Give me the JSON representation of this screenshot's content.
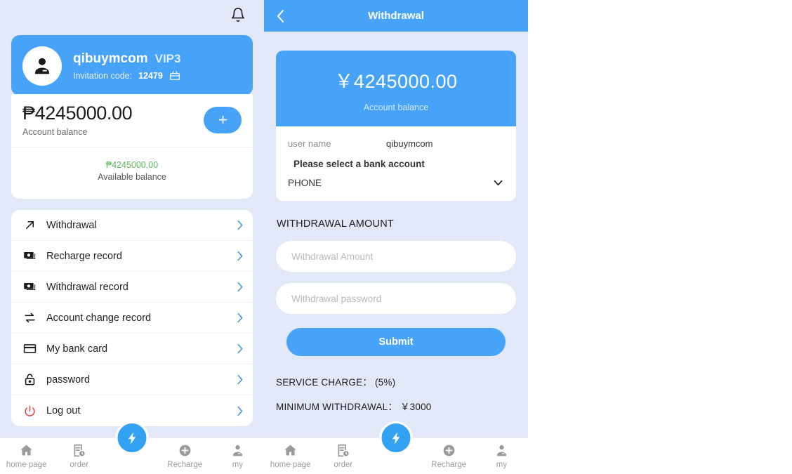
{
  "left_panel": {
    "bell_icon": "bell-icon",
    "profile": {
      "avatar_icon": "user-avatar-icon",
      "username": "qibuymcom",
      "vip_level": "VIP3",
      "invitation_label": "Invitation code:",
      "invitation_code": "12479",
      "copy_icon": "gift-copy-icon"
    },
    "balance": {
      "amount": "₱4245000.00",
      "label": "Account balance",
      "add_icon": "plus-icon"
    },
    "available": {
      "amount": "₱4245000.00",
      "label": "Available balance",
      "color": "#5bb85b"
    },
    "menu": [
      {
        "label": "Withdrawal",
        "icon": "arrow-up-right-icon"
      },
      {
        "label": "Recharge record",
        "icon": "banknote-icon"
      },
      {
        "label": "Withdrawal record",
        "icon": "banknote-icon"
      },
      {
        "label": "Account change record",
        "icon": "exchange-arrows-icon"
      },
      {
        "label": "My bank card",
        "icon": "credit-card-icon"
      },
      {
        "label": "password",
        "icon": "lock-icon"
      },
      {
        "label": "Log out",
        "icon": "power-off-icon"
      }
    ]
  },
  "right_panel": {
    "header": {
      "title": "Withdrawal",
      "back_icon": "chevron-left-icon"
    },
    "balance": {
      "amount": "￥4245000.00",
      "label": "Account balance"
    },
    "form": {
      "username_label": "user name",
      "username_value": "qibuymcom",
      "bank_select_title": "Please select a bank account",
      "bank_selected": "PHONE",
      "bank_chevron_icon": "chevron-down-icon"
    },
    "amount_section_label": "WITHDRAWAL AMOUNT",
    "amount_placeholder": "Withdrawal Amount",
    "amount_value": "",
    "password_placeholder": "Withdrawal password",
    "password_value": "",
    "submit_label": "Submit",
    "service_charge": "SERVICE CHARGE：  (5%)",
    "minimum_withdrawal": "MINIMUM WITHDRAWAL：  ￥3000"
  },
  "tabbar": {
    "items": [
      {
        "label": "home page",
        "icon": "home-icon"
      },
      {
        "label": "order",
        "icon": "order-clock-icon"
      },
      {
        "label": "Recharge",
        "icon": "plus-circle-icon"
      },
      {
        "label": "my",
        "icon": "person-icon"
      }
    ],
    "fab_icon": "lightning-bolt-icon"
  },
  "theme": {
    "accent": "#47a3f7",
    "page_bg": "#e2e8f8",
    "card_bg": "#ffffff",
    "green": "#5bb85b",
    "red": "#e04545"
  }
}
